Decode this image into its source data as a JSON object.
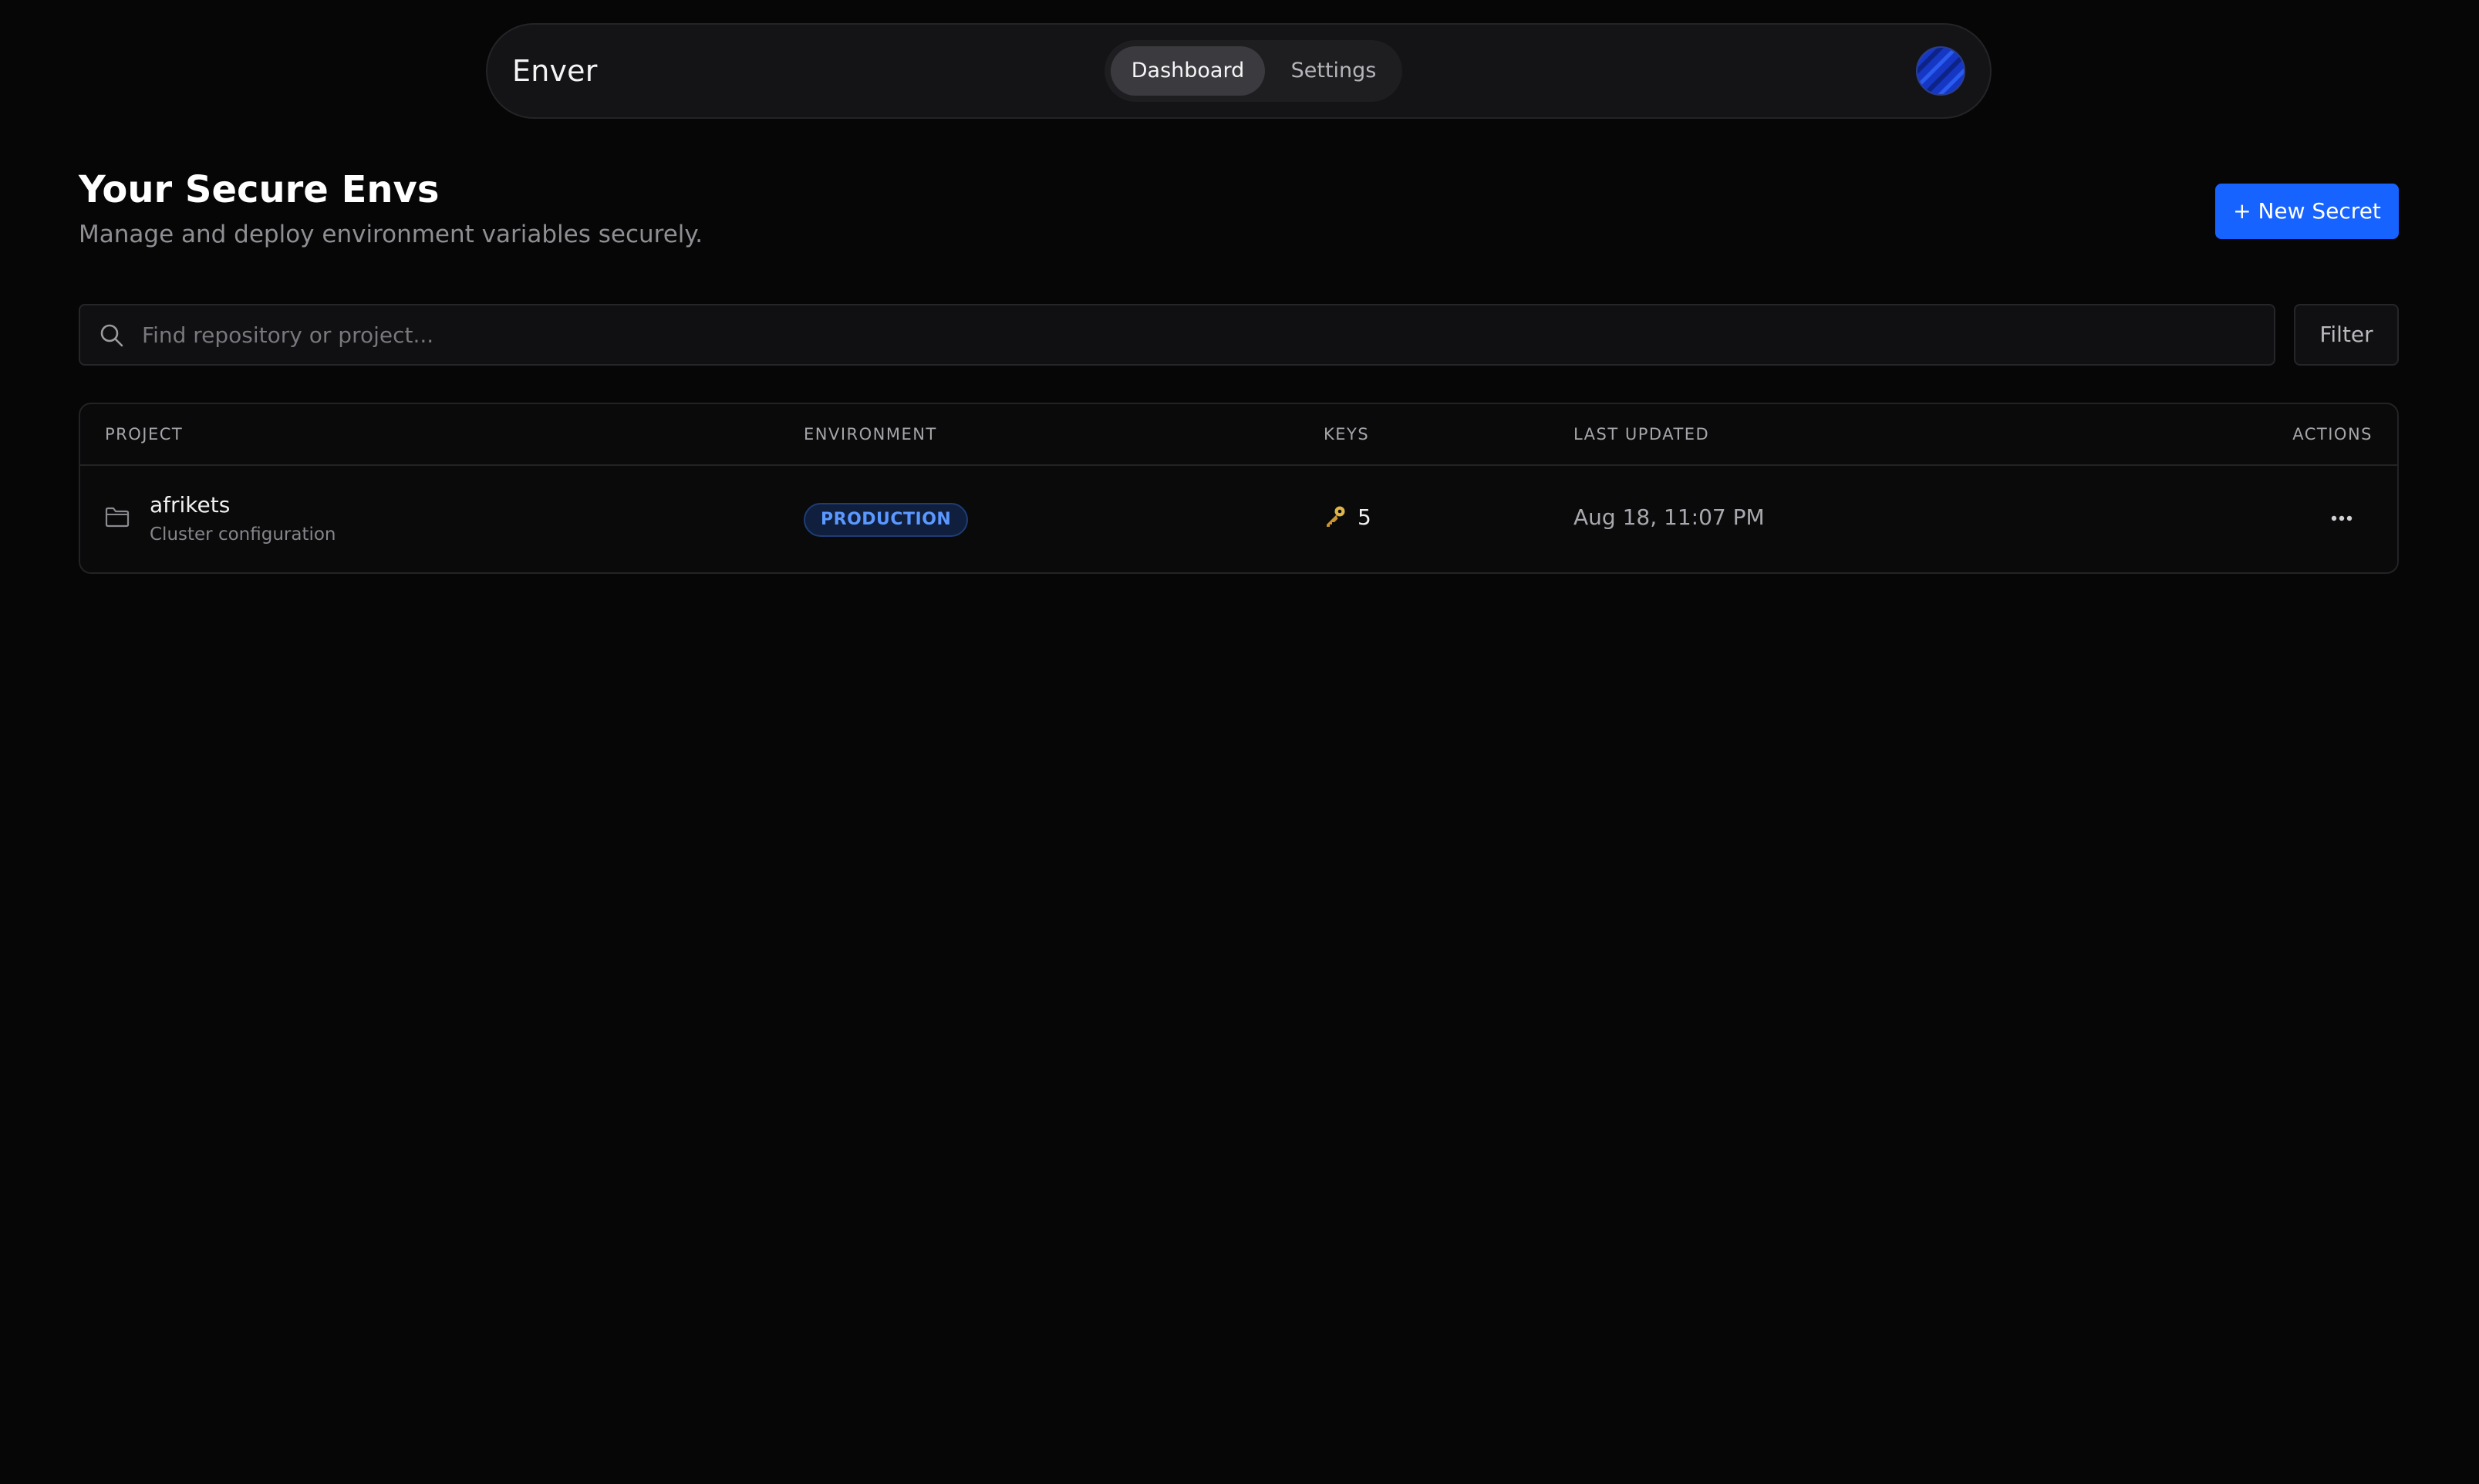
{
  "nav": {
    "brand": "Enver",
    "tabs": [
      {
        "label": "Dashboard",
        "active": true
      },
      {
        "label": "Settings",
        "active": false
      }
    ],
    "avatar_icon": "user-avatar-icon"
  },
  "header": {
    "title": "Your Secure Envs",
    "subtitle": "Manage and deploy environment variables securely.",
    "new_button_label": "+ New Secret"
  },
  "search": {
    "placeholder": "Find repository or project...",
    "value": "",
    "icon": "search-icon"
  },
  "filter": {
    "label": "Filter"
  },
  "table": {
    "columns": [
      "PROJECT",
      "ENVIRONMENT",
      "KEYS",
      "LAST UPDATED",
      "ACTIONS"
    ],
    "rows": [
      {
        "project_name": "afrikets",
        "project_description": "Cluster configuration",
        "environment": "PRODUCTION",
        "keys": "5",
        "last_updated": "Aug 18, 11:07 PM"
      }
    ]
  },
  "colors": {
    "background": "#060606",
    "accent": "#1763ff",
    "badge_text": "#5b98ff",
    "key_icon": "#e0b54a"
  }
}
